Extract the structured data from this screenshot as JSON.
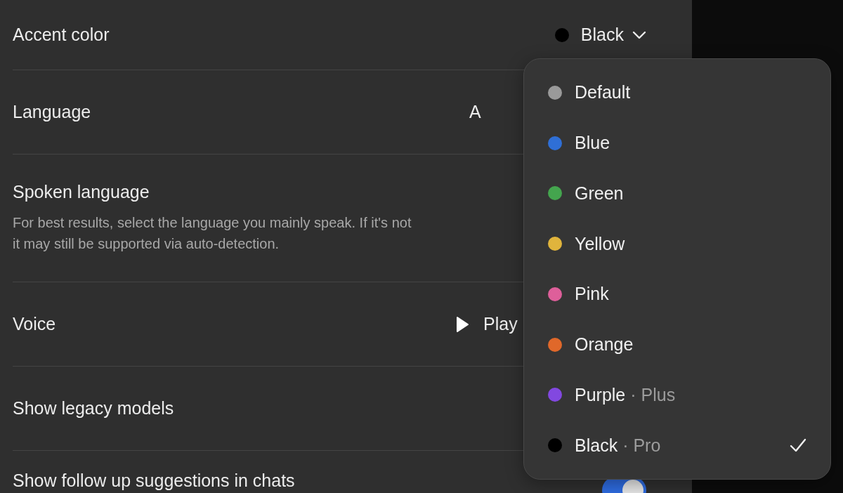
{
  "settings": [
    {
      "kind": "select",
      "label": "Accent color",
      "value": "Black",
      "color": "#000000"
    },
    {
      "kind": "value",
      "label": "Language",
      "value": "A"
    },
    {
      "kind": "description",
      "label": "Spoken language",
      "description_lines": [
        "For best results, select the language you mainly speak. If it's not",
        "it may still be supported via auto-detection."
      ]
    },
    {
      "kind": "play",
      "label": "Voice",
      "value": "Play"
    },
    {
      "kind": "plain",
      "label": "Show legacy models"
    },
    {
      "kind": "toggle",
      "label": "Show follow up suggestions in chats",
      "on": true
    }
  ],
  "accent_menu": {
    "items": [
      {
        "label": "Default",
        "color": "#9a9a9a",
        "selected": false
      },
      {
        "label": "Blue",
        "color": "#2f6fd6",
        "selected": false
      },
      {
        "label": "Green",
        "color": "#44a54e",
        "selected": false
      },
      {
        "label": "Yellow",
        "color": "#e0b43c",
        "selected": false
      },
      {
        "label": "Pink",
        "color": "#de5f9a",
        "selected": false
      },
      {
        "label": "Orange",
        "color": "#e0682a",
        "selected": false
      },
      {
        "label": "Purple",
        "tier": "· Plus",
        "color": "#8248e0",
        "selected": false
      },
      {
        "label": "Black",
        "tier": "· Pro",
        "color": "#000000",
        "selected": true
      }
    ]
  }
}
